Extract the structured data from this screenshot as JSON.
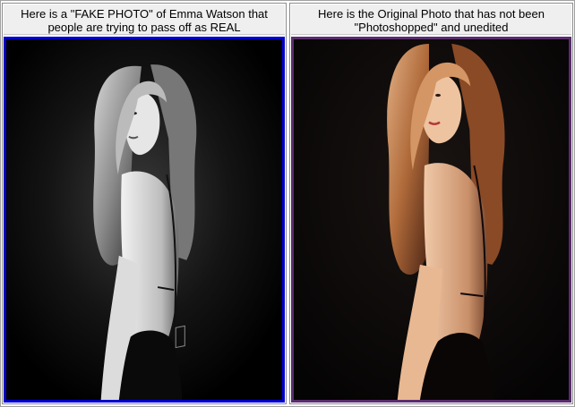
{
  "panels": [
    {
      "caption": "Here is a \"FAKE PHOTO\" of Emma Watson that people are trying to pass off as REAL",
      "border_color": "#0000cc",
      "photo": "grayscale portrait, dark background, long hair, black backless dress"
    },
    {
      "caption": "Here is the Original Photo that has not been \"Photoshopped\" and unedited",
      "border_color": "#5a2d6e",
      "photo": "color portrait, dark background, long auburn hair, black backless dress"
    }
  ]
}
